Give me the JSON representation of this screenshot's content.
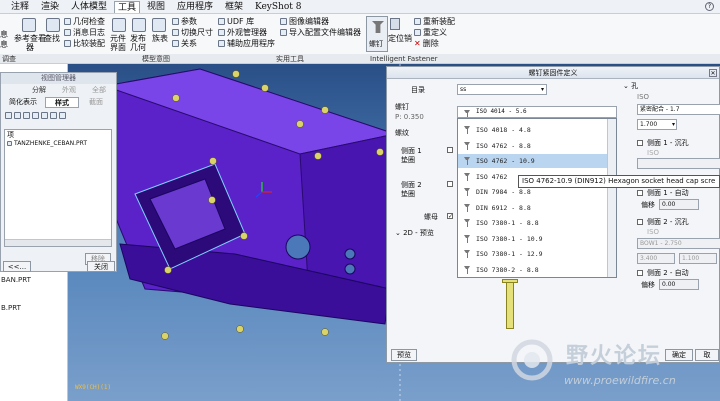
{
  "menubar": {
    "items": [
      "注释",
      "渲染",
      "人体模型",
      "工具",
      "视图",
      "应用程序",
      "框架",
      "KeyShot 8"
    ],
    "active": "工具"
  },
  "ribbon": {
    "left_fragments": [
      "息",
      "息"
    ],
    "ref_viewer": "参考查看器",
    "find": "查找",
    "geo_check": "几何检查",
    "msg_log": "消息日志",
    "compare": "比较装配",
    "component_ui": "元件界面",
    "publish_geo": "发布几何",
    "family_table": "族表",
    "params": "参数",
    "switch_dim": "切换尺寸",
    "relations": "关系",
    "udf": "UDF 库",
    "ext_manager": "外观管理器",
    "aux_app": "辅助应用程序",
    "graph_editor": "图像编辑器",
    "import_cfg": "导入配置文件编辑器",
    "bolt": "螺钉",
    "locate": "定位销",
    "reassemble": "重新装配",
    "redefine": "重定义",
    "delete": "删除"
  },
  "groups": [
    "调查",
    "模型意图",
    "实用工具",
    "Intelligent Fastener"
  ],
  "left_nav": {
    "items": [
      "BAN.PRT",
      "B.PRT"
    ]
  },
  "view_manager": {
    "title": "视图管理器",
    "tabs": [
      "分解",
      "外观",
      "全部"
    ],
    "subtabs": [
      "简化表示",
      "样式",
      "截面"
    ],
    "list_header": "项",
    "item": "TANZHENKE_CEBAN.PRT",
    "remove": "移除",
    "back": "<<...",
    "close": "关闭"
  },
  "dialog": {
    "title": "螺钉紧固件定义",
    "catalog_label": "目录",
    "catalog_value": "ss",
    "screw_label": "螺钉",
    "screw_value": "ISO 4014 - 5.6",
    "p_value": "P: 0.350",
    "washer_label": "螺纹",
    "side1": "侧面 1",
    "side1b": "垫圈",
    "side2": "侧面 2",
    "side2b": "垫圈",
    "nut_label": "螺母",
    "preview2d": "2D - 预览",
    "preview_btn": "预览",
    "ok": "确定",
    "cancel": "取",
    "hole_label": "孔",
    "hole_std": "ISO",
    "fit": "紧密配合 - 1.7",
    "val1": "1.700",
    "side1_csk": "侧面 1 - 沉孔",
    "side1_csk_std": "ISO",
    "side1_auto": "侧面 1 - 自动",
    "offset1": "偏移",
    "offset1_val": "0.00",
    "side2_csk": "侧面 2 - 沉孔",
    "side2_csk_std": "ISO",
    "bow": "BOW1 - 2.750",
    "val2": "3.400",
    "val3": "1.100",
    "side2_auto": "侧面 2 - 自动",
    "offset2": "偏移",
    "offset2_val": "0.00"
  },
  "dropdown": {
    "items": [
      "ISO 4018 - 4.8",
      "ISO 4762 - 8.8",
      "ISO 4762 - 10.9",
      "ISO 4762",
      "DIN 7984 - 8.8",
      "DIN 6912 - 8.8",
      "ISO 7380-1 - 8.8",
      "ISO 7380-1 - 10.9",
      "ISO 7380-1 - 12.9",
      "ISO 7380-2 - 8.8"
    ],
    "selected": "ISO 4762 - 10.9"
  },
  "tooltip": "ISO 4762-10.9 (DIN912) Hexagon socket head cap scre",
  "statusbar": "WX9(CH)(1)",
  "watermark": {
    "cn": "野火论坛",
    "url": "www.proewildfire.cn"
  },
  "colors": {
    "model": "#6a2fd8",
    "viewport_top": "#2a4f87",
    "selection": "#b9d5f0",
    "screw": "#e6e07a"
  }
}
